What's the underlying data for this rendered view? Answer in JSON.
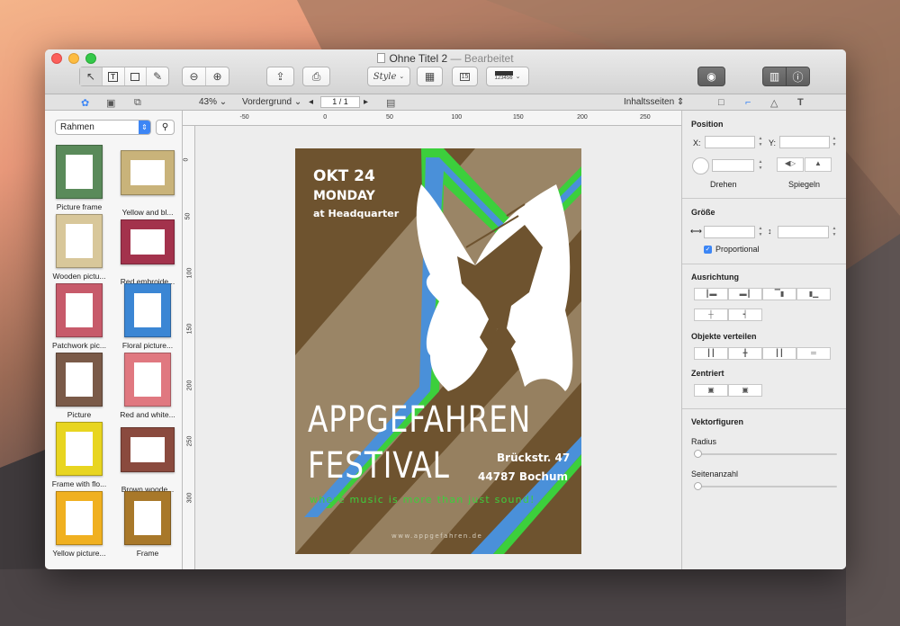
{
  "window": {
    "title": "Ohne Titel 2",
    "edited": "— Bearbeitet"
  },
  "toolbar": {
    "style_label": "Style",
    "calendar_label": "15",
    "barcode_label": "123456"
  },
  "panelbar": {
    "zoom": "43%",
    "layer": "Vordergrund",
    "page": "1 / 1",
    "pages_menu": "Inhaltsseiten"
  },
  "library": {
    "category": "Rahmen",
    "items": [
      {
        "label": "Picture frame",
        "color": "#5a8a5a"
      },
      {
        "label": "Yellow and bl...",
        "color": "#c9b37a"
      },
      {
        "label": "Wooden pictu...",
        "color": "#d8c79a"
      },
      {
        "label": "Red embroide...",
        "color": "#a3324c"
      },
      {
        "label": "Patchwork pic...",
        "color": "#c75a6a"
      },
      {
        "label": "Floral picture...",
        "color": "#3b86d4"
      },
      {
        "label": "Picture",
        "color": "#7a5a48"
      },
      {
        "label": "Red and white...",
        "color": "#e07880"
      },
      {
        "label": "Frame with flo...",
        "color": "#e8d520"
      },
      {
        "label": "Brown woode...",
        "color": "#8a4a3e"
      },
      {
        "label": "Yellow picture...",
        "color": "#f0b020"
      },
      {
        "label": "Frame",
        "color": "#a8782a"
      }
    ]
  },
  "ruler": {
    "unit": "mm",
    "top_ticks": [
      "-50",
      "0",
      "50",
      "100",
      "150",
      "200",
      "250"
    ],
    "left_ticks": [
      "0",
      "50",
      "100",
      "150",
      "200",
      "250",
      "300"
    ]
  },
  "poster": {
    "date": "OKT 24",
    "day": "MONDAY",
    "venue": "at Headquarter",
    "title1": "APPGEFAHREN",
    "title2": "FESTIVAL",
    "street": "Brückstr. 47",
    "city": "44787 Bochum",
    "tagline": "where music is more than just sound!",
    "url": "www.appgefahren.de",
    "colors": {
      "bg": "#6e532f",
      "stripe_light": "#9a8566",
      "blue": "#4a90d9",
      "green": "#3ccf3c"
    }
  },
  "inspector": {
    "position_title": "Position",
    "x_label": "X:",
    "y_label": "Y:",
    "rotate_label": "Drehen",
    "mirror_label": "Spiegeln",
    "size_title": "Größe",
    "proportional_label": "Proportional",
    "align_title": "Ausrichtung",
    "distribute_title": "Objekte verteilen",
    "center_title": "Zentriert",
    "vector_title": "Vektorfiguren",
    "radius_label": "Radius",
    "sides_label": "Seitenanzahl",
    "radius_value": 0,
    "sides_value": 0
  }
}
